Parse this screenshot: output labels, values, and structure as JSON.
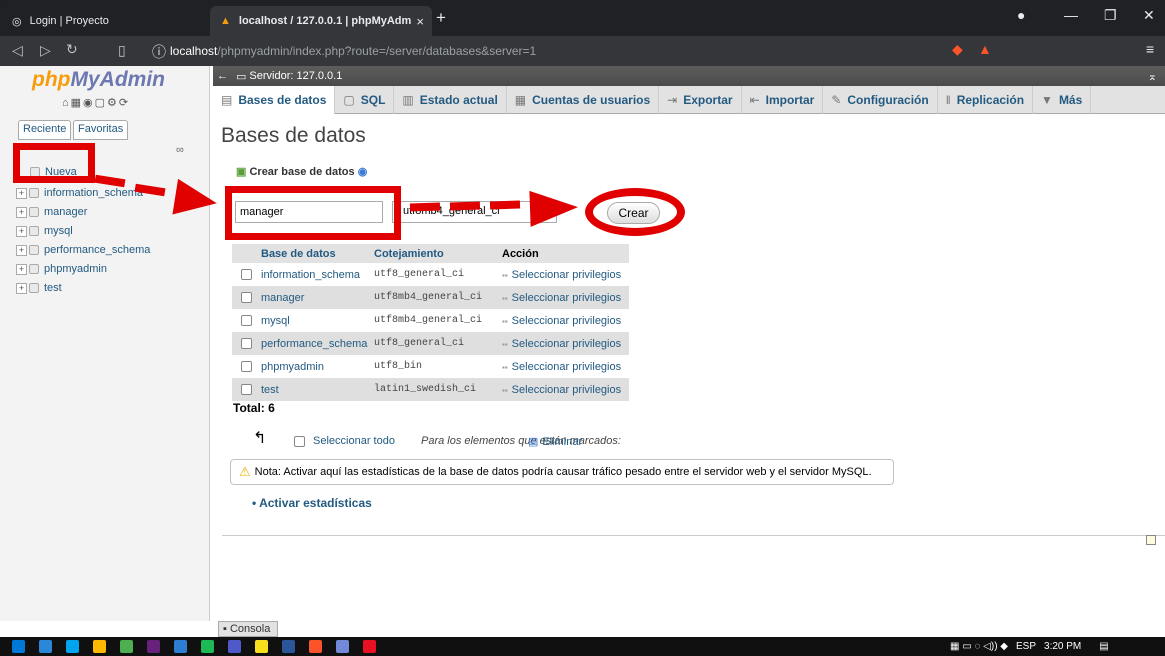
{
  "browser": {
    "tabs": [
      {
        "title": "Login | Proyecto",
        "active": false
      },
      {
        "title": "localhost / 127.0.0.1 | phpMyAdm",
        "active": true
      }
    ],
    "url_host": "localhost",
    "url_path": "/phpmyadmin/index.php?route=/server/databases&server=1"
  },
  "sidebar": {
    "logo_php": "php",
    "logo_myadmin": "MyAdmin",
    "tab_recent": "Reciente",
    "tab_favorites": "Favoritas",
    "new_label": "Nueva",
    "databases": [
      "information_schema",
      "manager",
      "mysql",
      "performance_schema",
      "phpmyadmin",
      "test"
    ]
  },
  "server_bar": "Servidor: 127.0.0.1",
  "menu": [
    "Bases de datos",
    "SQL",
    "Estado actual",
    "Cuentas de usuarios",
    "Exportar",
    "Importar",
    "Configuración",
    "Replicación",
    "Más"
  ],
  "page": {
    "title": "Bases de datos",
    "create_label": "Crear base de datos",
    "db_name_value": "manager",
    "collation_value": "utf8mb4_general_ci",
    "create_button": "Crear"
  },
  "table": {
    "headers": [
      "Base de datos",
      "Cotejamiento",
      "Acción"
    ],
    "rows": [
      {
        "name": "information_schema",
        "collation": "utf8_general_ci",
        "action": "Seleccionar privilegios"
      },
      {
        "name": "manager",
        "collation": "utf8mb4_general_ci",
        "action": "Seleccionar privilegios"
      },
      {
        "name": "mysql",
        "collation": "utf8mb4_general_ci",
        "action": "Seleccionar privilegios"
      },
      {
        "name": "performance_schema",
        "collation": "utf8_general_ci",
        "action": "Seleccionar privilegios"
      },
      {
        "name": "phpmyadmin",
        "collation": "utf8_bin",
        "action": "Seleccionar privilegios"
      },
      {
        "name": "test",
        "collation": "latin1_swedish_ci",
        "action": "Seleccionar privilegios"
      }
    ],
    "total": "Total: 6"
  },
  "bulk": {
    "select_all": "Seleccionar todo",
    "with_selected": "Para los elementos que están marcados:",
    "delete": "Eliminar"
  },
  "notice": "Nota: Activar aquí las estadísticas de la base de datos podría causar tráfico pesado entre el servidor web y el servidor MySQL.",
  "activate_stats": "Activar estadísticas",
  "console": "Consola",
  "tray": {
    "lang": "ESP",
    "time": "3:20 PM"
  },
  "colors": {
    "annotation_red": "#e00000",
    "link_blue": "#235a81"
  }
}
